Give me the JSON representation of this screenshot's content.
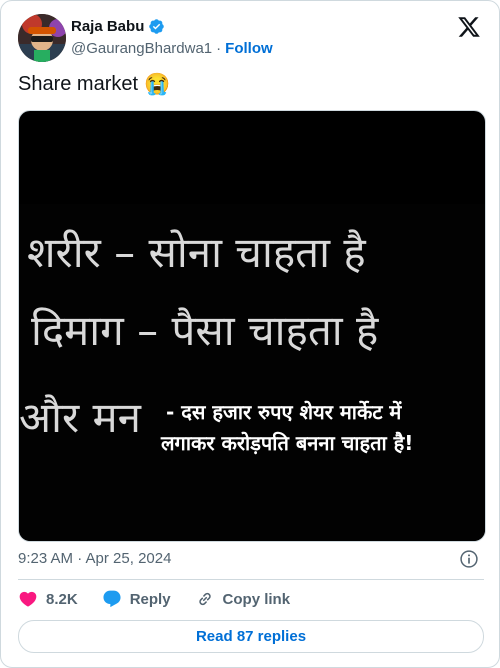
{
  "author": {
    "name": "Raja Babu",
    "handle": "@GaurangBhardwa1",
    "separator": "·",
    "follow_label": "Follow"
  },
  "tweet": {
    "text": "Share market",
    "emoji": "😭"
  },
  "image": {
    "line1": "शरीर –  सोना चाहता है",
    "line2": "दिमाग – पैसा चाहता है",
    "line3": "और मन",
    "line4": "- दस हजार रुपए शेयर मार्केट में",
    "line5": "लगाकर करोड़पति बनना चाहता है!"
  },
  "timestamp": "9:23 AM · Apr 25, 2024",
  "actions": {
    "likes": "8.2K",
    "reply_label": "Reply",
    "copy_label": "Copy link"
  },
  "read_replies_label": "Read 87 replies",
  "colors": {
    "accent": "#006fd6",
    "like": "#f91880",
    "verified": "#1d9bf0",
    "muted": "#536471",
    "border": "#cfd9de"
  }
}
